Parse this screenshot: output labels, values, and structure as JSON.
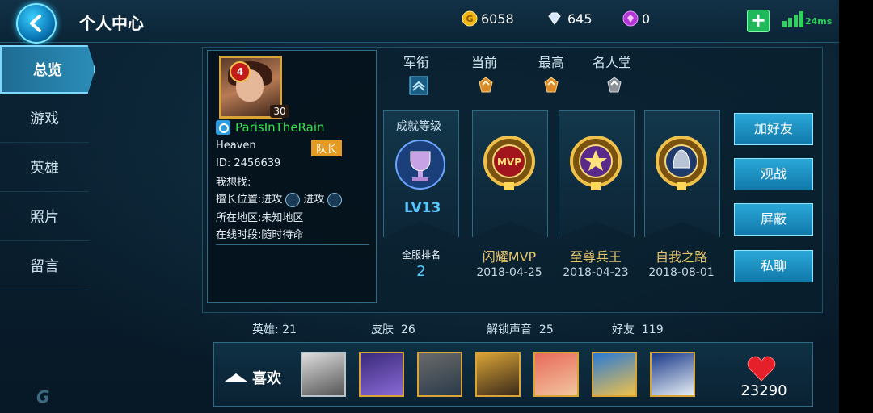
{
  "header": {
    "title": "个人中心",
    "gold": "6058",
    "diamonds": "645",
    "gems": "0",
    "ping": "24ms"
  },
  "sidebar": {
    "items": [
      {
        "label": "总览"
      },
      {
        "label": "游戏"
      },
      {
        "label": "英雄"
      },
      {
        "label": "照片"
      },
      {
        "label": "留言"
      }
    ]
  },
  "profile": {
    "level_badge": "4",
    "avatar_level": "30",
    "name": "ParisInTheRain",
    "guild": "Heaven",
    "role": "队长",
    "id_label": "ID:",
    "id": "2456639",
    "looking_label": "我想找:",
    "position_label": "擅长位置:",
    "position1": "进攻",
    "position2": "进攻",
    "region_label": "所在地区:",
    "region": "未知地区",
    "online_label": "在线时段:",
    "online": "随时待命"
  },
  "ranks": {
    "labels": [
      "军衔",
      "当前",
      "最高",
      "名人堂"
    ]
  },
  "achievement_level": {
    "title": "成就等级",
    "level": "LV13",
    "server_rank_label": "全服排名",
    "server_rank": "2"
  },
  "achievements": [
    {
      "name": "闪耀MVP",
      "date": "2018-04-25"
    },
    {
      "name": "至尊兵王",
      "date": "2018-04-23"
    },
    {
      "name": "自我之路",
      "date": "2018-08-01"
    }
  ],
  "actions": {
    "add_friend": "加好友",
    "spectate": "观战",
    "block": "屏蔽",
    "chat": "私聊"
  },
  "stats": {
    "heroes_label": "英雄:",
    "heroes": "21",
    "skins_label": "皮肤",
    "skins": "26",
    "voices_label": "解锁声音",
    "voices": "25",
    "friends_label": "好友",
    "friends": "119"
  },
  "favorites": {
    "label": "喜欢",
    "likes_count": "23290"
  },
  "colors": {
    "accent": "#2aa8d8",
    "gold": "#d9a336",
    "name_green": "#39e04f"
  }
}
